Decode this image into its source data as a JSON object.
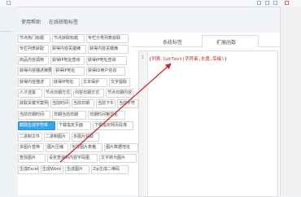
{
  "header": {
    "icons": [
      "window-icon",
      "check-icon",
      "settings-icon",
      "calendar-icon",
      "close-icon"
    ]
  },
  "tabs": {
    "items": [
      "使用帮助",
      "在线获取标签"
    ]
  },
  "tags": {
    "rows": [
      [
        "节点热门标题",
        "节点获取标题",
        "专栏分类列表获取"
      ],
      [
        "专栏列表获取",
        "获得内容关键摘",
        "获得内容关键摘"
      ],
      [
        "商品内容调用",
        "获得IP地址查询",
        "获得IP地址查询"
      ],
      [
        "获得内容描述摘要",
        "获得IP地址",
        "获得ID用户信息"
      ],
      [
        "获得内容描述",
        "获得IP地址",
        "文本保护",
        "文字提取"
      ],
      [
        "人才选拔",
        "节点日期方式",
        "内容日期方式",
        "节点日期内容"
      ],
      [
        "获取关键字案例",
        "当前时间",
        "当前日期",
        "当前下午",
        "当前字符"
      ],
      [
        "当前日期时间",
        "日期当前日期",
        "日期时间格式化"
      ],
      [
        "截取生成字符串",
        "下载指定页面",
        "下载指定网页段落"
      ],
      [
        "二进制文件",
        "二进制图片",
        "多图片获取"
      ],
      [
        "多图片替换",
        "图片压缩",
        "字段图片表格",
        "图片数据地址"
      ],
      [
        "查找图片",
        "设定查询到内容字段图",
        "文字转为图片"
      ],
      [
        "生成Excel",
        "生成Word",
        "生成图片",
        "Zip生成二维码"
      ]
    ],
    "selected": "截取生成字符串"
  },
  "right_panel": {
    "tabs": [
      "系统标签",
      "扩展函数"
    ],
    "active_tab": "扩展函数"
  },
  "editor": {
    "line_number": "1",
    "code_prefix": "{",
    "code_body": "列表.CutText(字符串,长度,后缀)",
    "code_suffix": "}"
  },
  "colors": {
    "accent": "#3aa6ea",
    "code_highlight": "#b41e1e",
    "arrow": "#d02020"
  }
}
